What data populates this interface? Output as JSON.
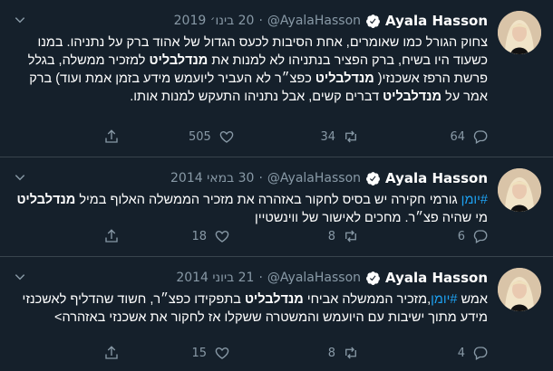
{
  "tweets": [
    {
      "name": "Ayala Hasson",
      "handle": "@AyalaHasson",
      "separator": "·",
      "date": "20 בינו׳ 2019",
      "body": [
        {
          "t": "צחוק הגורל כמו שאומרים, אחת הסיבות לכעס הגדול של אהוד ברק על נתניהו. במנו כשעוד היו בשיח, ברק הפציר בנתניהו לא למנות את "
        },
        {
          "t": "מנדלבליט",
          "b": true
        },
        {
          "t": " למזכיר ממשלה, בגלל פרשת הרפז אשכנזי( "
        },
        {
          "t": "מנדלבליט",
          "b": true
        },
        {
          "t": " כפצ״ר לא העביר ליועמש מידע בזמן אמת ועוד) ברק אמר על "
        },
        {
          "t": "מנדלבליט",
          "b": true
        },
        {
          "t": " דברים קשים, אבל נתניהו התעקש למנות אותו."
        }
      ],
      "replies": "64",
      "retweets": "34",
      "likes": "505"
    },
    {
      "name": "Ayala Hasson",
      "handle": "@AyalaHasson",
      "separator": "·",
      "date": "30 במאי 2014",
      "body": [
        {
          "t": "#יומן",
          "tag": true
        },
        {
          "t": " גורמי חקירה יש בסיס לחקור באזהרה את מזכיר הממשלה האלוף במיל "
        },
        {
          "t": "מנדלבליט",
          "b": true
        },
        {
          "t": " מי שהיה פצ״ר. מחכים לאישור של ווינשטיין"
        }
      ],
      "replies": "6",
      "retweets": "8",
      "likes": "18"
    },
    {
      "name": "Ayala Hasson",
      "handle": "@AyalaHasson",
      "separator": "·",
      "date": "21 ביוני 2014",
      "body": [
        {
          "t": "אמש "
        },
        {
          "t": "#יומן",
          "tag": true
        },
        {
          "t": ",מזכיר הממשלה אביחי "
        },
        {
          "t": "מנדלבליט",
          "b": true
        },
        {
          "t": " בתפקידו כפצ״ר, חשוד שהדליף לאשכנזי מידע מתוך ישיבות עם היועמש והמשטרה ששקלו אז לחקור את אשכנזי באזהרה>"
        }
      ],
      "replies": "4",
      "retweets": "8",
      "likes": "15"
    }
  ],
  "colors": {
    "background": "#15202b",
    "divider": "#38444d",
    "muted": "#8899a6",
    "link": "#1da1f2",
    "verified": "#ffffff"
  },
  "icons": {
    "verified": "verified-badge-icon",
    "more": "chevron-down-icon",
    "reply": "reply-icon",
    "retweet": "retweet-icon",
    "like": "heart-icon",
    "share": "share-icon"
  }
}
